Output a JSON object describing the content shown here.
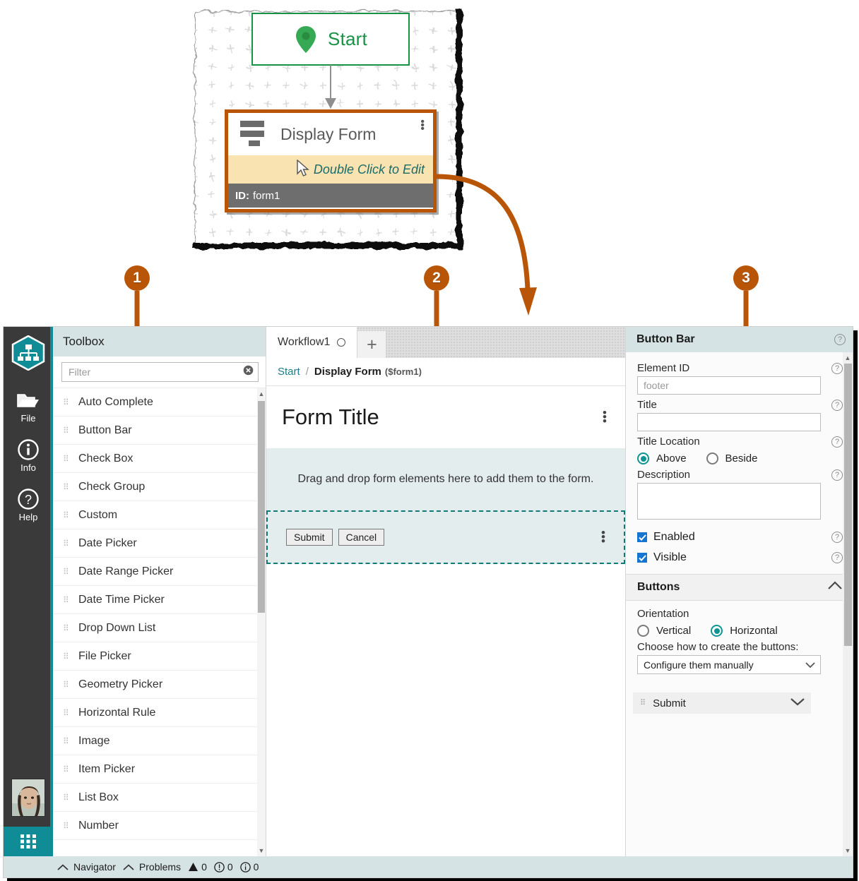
{
  "diagram": {
    "start_node": {
      "label": "Start",
      "icon": "location-pin-icon"
    },
    "form_node": {
      "title": "Display Form",
      "icon": "form-layout-icon",
      "edit_hint": "Double Click to Edit",
      "id_label": "ID:",
      "id_value": "form1",
      "kebab": "⋮"
    }
  },
  "callouts": [
    {
      "number": "1"
    },
    {
      "number": "2"
    },
    {
      "number": "3"
    }
  ],
  "rail": {
    "logo": "hierarchy-logo-icon",
    "items": [
      {
        "label": "File",
        "icon": "folder-icon"
      },
      {
        "label": "Info",
        "icon": "info-circle-icon"
      },
      {
        "label": "Help",
        "icon": "question-circle-icon"
      }
    ],
    "avatar": "user-avatar",
    "apps": "app-grid-icon"
  },
  "toolbox": {
    "header": "Toolbox",
    "filter": {
      "value": "",
      "placeholder": "Filter",
      "clear_icon": "clear-circle-icon"
    },
    "items": [
      {
        "label": "Auto Complete"
      },
      {
        "label": "Button Bar"
      },
      {
        "label": "Check Box"
      },
      {
        "label": "Check Group"
      },
      {
        "label": "Custom"
      },
      {
        "label": "Date Picker"
      },
      {
        "label": "Date Range Picker"
      },
      {
        "label": "Date Time Picker"
      },
      {
        "label": "Drop Down List"
      },
      {
        "label": "File Picker"
      },
      {
        "label": "Geometry Picker"
      },
      {
        "label": "Horizontal Rule"
      },
      {
        "label": "Image"
      },
      {
        "label": "Item Picker"
      },
      {
        "label": "List Box"
      },
      {
        "label": "Number"
      }
    ]
  },
  "center": {
    "tab": {
      "label": "Workflow1",
      "status_icon": "circle-outline-icon"
    },
    "new_tab": "+",
    "breadcrumb": {
      "root": "Start",
      "separator": "/",
      "current": "Display Form",
      "variable": "($form1)"
    },
    "form": {
      "title": "Form Title",
      "kebab": "⋮",
      "dropzone_text": "Drag and drop form elements here to add them to the form.",
      "buttonbar": {
        "buttons": [
          {
            "label": "Submit"
          },
          {
            "label": "Cancel"
          }
        ],
        "kebab": "⋮"
      }
    }
  },
  "properties": {
    "header": {
      "title": "Button Bar",
      "help": "?"
    },
    "element_id": {
      "label": "Element ID",
      "value": "",
      "placeholder": "footer",
      "help": "?"
    },
    "title": {
      "label": "Title",
      "value": "",
      "placeholder": "",
      "help": "?"
    },
    "title_location": {
      "label": "Title Location",
      "help": "?",
      "options": [
        {
          "label": "Above",
          "selected": true
        },
        {
          "label": "Beside",
          "selected": false
        }
      ]
    },
    "description": {
      "label": "Description",
      "value": "",
      "help": "?"
    },
    "enabled": {
      "label": "Enabled",
      "checked": true,
      "help": "?"
    },
    "visible": {
      "label": "Visible",
      "checked": true,
      "help": "?"
    },
    "buttons_group": {
      "title": "Buttons",
      "collapse_icon": "chevron-up-icon",
      "orientation": {
        "label": "Orientation",
        "options": [
          {
            "label": "Vertical",
            "selected": false
          },
          {
            "label": "Horizontal",
            "selected": true
          }
        ]
      },
      "create_label": "Choose how to create the buttons:",
      "create_select": {
        "value": "Configure them manually",
        "icon": "chevron-down-icon"
      },
      "list": [
        {
          "label": "Submit",
          "icon": "chevron-down-icon"
        }
      ]
    }
  },
  "statusbar": {
    "navigator": {
      "label": "Navigator",
      "icon": "chevron-up-icon"
    },
    "problems": {
      "label": "Problems",
      "icon": "chevron-up-icon"
    },
    "counts": [
      {
        "icon": "warning-triangle-icon",
        "value": "0"
      },
      {
        "icon": "error-circle-icon",
        "value": "0"
      },
      {
        "icon": "info-circle-icon",
        "value": "0"
      }
    ]
  },
  "colors": {
    "accent_orange": "#b85507",
    "teal": "#0f8c96",
    "green": "#1a9245",
    "header_bg": "#d6e3e4",
    "dropzone_bg": "#e4edee",
    "radio_on": "#0e9494",
    "checkbox_blue": "#1575d1"
  }
}
